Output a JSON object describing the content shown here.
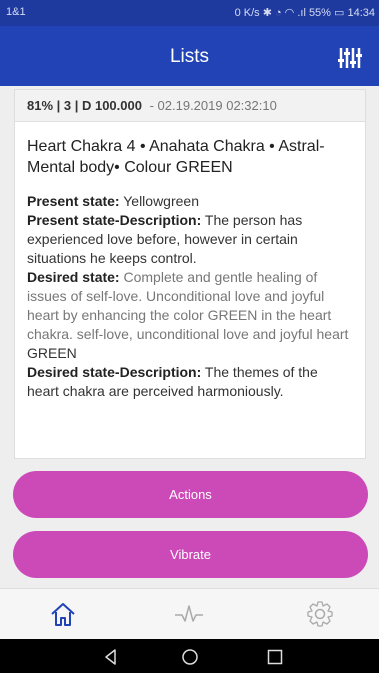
{
  "status_bar": {
    "left_text": "1&1",
    "right_text": "0 K/s ✱ ◔ ◠ .ıl 55% ▭ 14:34"
  },
  "app_bar": {
    "title": "Lists",
    "filter_icon": "equalizer-icon"
  },
  "card": {
    "meta": "81% | 3 | D 100.000",
    "date": "- 02.19.2019 02:32:10",
    "title": "Heart Chakra 4 • Anahata Chakra • Astral- Mental body• Colour GREEN",
    "present_state_label": "Present state:",
    "present_state_value": " Yellowgreen",
    "present_desc_label": "Present state-Description:",
    "present_desc_value": " The person has experienced love before, however in certain situations he keeps control.",
    "desired_state_label": "Desired state:",
    "desired_state_value": " Complete and gentle healing of issues of self-love. Unconditional love and joyful heart by enhancing the color GREEN in the heart chakra. self-love, unconditional love and joyful heart ",
    "desired_state_color": "GREEN",
    "desired_desc_label": "Desired state-Description:",
    "desired_desc_value": " The themes of the heart chakra are perceived harmoniously."
  },
  "buttons": {
    "actions": "Actions",
    "vibrate": "Vibrate"
  },
  "tab_bar": {
    "tabs": [
      {
        "icon": "home-icon",
        "active": true
      },
      {
        "icon": "pulse-icon",
        "active": false
      },
      {
        "icon": "gear-icon",
        "active": false
      }
    ]
  },
  "nav_bar": {
    "icons": [
      "back-icon",
      "home-circle-icon",
      "recents-icon"
    ]
  },
  "colors": {
    "app_bar": "#2243b6",
    "accent_pill": "#cc49b8",
    "active_tab": "#2243b6",
    "inactive_tab": "#aaaaaa"
  }
}
